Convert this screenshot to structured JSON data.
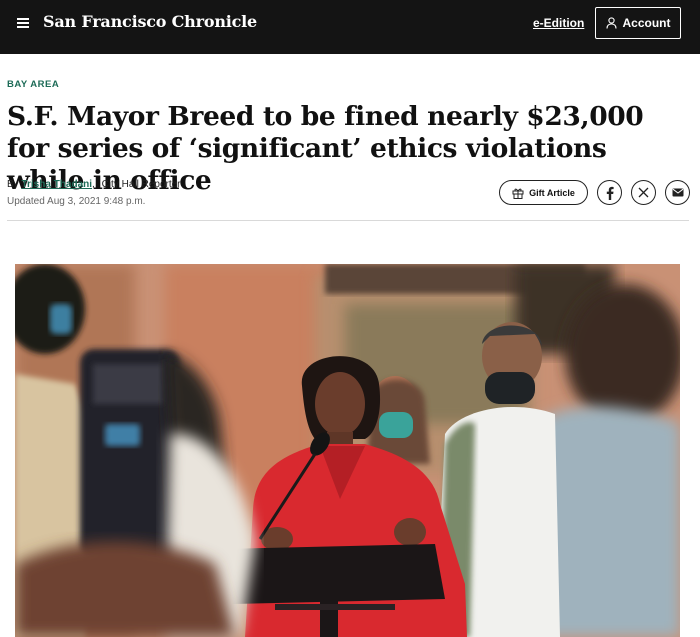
{
  "header": {
    "logo": "San Francisco Chronicle",
    "eedition_label": "e-Edition",
    "account_label": "Account"
  },
  "article": {
    "section": "BAY AREA",
    "headline": "S.F. Mayor Breed to be fined nearly $23,000 for series of ‘significant’ ethics violations while in office",
    "by_prefix": "By",
    "author": "Trisha Thadani",
    "author_sep": ",",
    "role": "City Hall Reporter",
    "updated": "Updated Aug 3, 2021 9:48 p.m."
  },
  "share": {
    "gift_label": "Gift Article",
    "icons": [
      "gift-icon",
      "facebook-icon",
      "x-icon",
      "email-icon"
    ]
  },
  "colors": {
    "topbar": "#141414",
    "section_green": "#1d6b57",
    "red_dress": "#d9292f"
  }
}
